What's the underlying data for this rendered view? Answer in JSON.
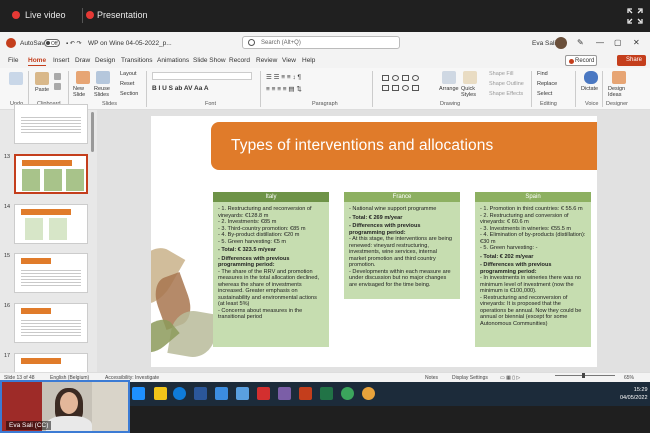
{
  "meeting": {
    "live_label": "Live video",
    "present_label": "Presentation"
  },
  "titlebar": {
    "autosave": "AutoSave",
    "toggle": "Off",
    "filename": "WP on Wine 04-05-2022_p...",
    "search": "Search (Alt+Q)",
    "user": "Eva Sali"
  },
  "menu": {
    "tabs": [
      "File",
      "Home",
      "Insert",
      "Draw",
      "Design",
      "Transitions",
      "Animations",
      "Slide Show",
      "Record",
      "Review",
      "View",
      "Help"
    ],
    "record": "Record",
    "share": "Share"
  },
  "ribbon": {
    "groups": [
      "Undo",
      "Clipboard",
      "Slides",
      "Font",
      "Paragraph",
      "Drawing",
      "Editing",
      "Voice",
      "Designer"
    ],
    "paste": "Paste",
    "new_slide": "New Slide",
    "reuse_slides": "Reuse Slides",
    "layout": "Layout",
    "reset": "Reset",
    "section": "Section",
    "arrange": "Arrange",
    "quick_styles": "Quick Styles",
    "shape_fill": "Shape Fill",
    "shape_outline": "Shape Outline",
    "shape_effects": "Shape Effects",
    "find": "Find",
    "replace": "Replace",
    "select": "Select",
    "dictate": "Dictate",
    "design_ideas": "Design Ideas"
  },
  "thumbnails": [
    {
      "num": "13"
    },
    {
      "num": "14"
    },
    {
      "num": "15"
    },
    {
      "num": "16"
    },
    {
      "num": "17"
    }
  ],
  "slide": {
    "title": "Types of interventions and allocations",
    "columns": [
      {
        "header": "Italy",
        "lines": [
          {
            "t": "- 1. Restructuring and reconversion of vineyards: €128.8 m",
            "b": false
          },
          {
            "t": "- 2. Investments: €85 m",
            "b": false
          },
          {
            "t": "- 3. Third-country promotion: €85 m",
            "b": false
          },
          {
            "t": "- 4. By-product distillation: €20 m",
            "b": false
          },
          {
            "t": "- 5. Green harvesting: €5 m",
            "b": false
          },
          {
            "t": "- Total: € 323.5 m/year",
            "b": true
          },
          {
            "t": "- Differences with previous programming period:",
            "b": true
          },
          {
            "t": "- The share of the RRV and promotion measures in the total allocation declined, whereas the share of investments increased. Greater emphasis on sustainability and environmental actions (at least 5%)",
            "b": false
          },
          {
            "t": "- Concerns about measures in the transitional period",
            "b": false
          }
        ]
      },
      {
        "header": "France",
        "lines": [
          {
            "t": "- National wine support programme",
            "b": false
          },
          {
            "t": "- Total: € 269 m/year",
            "b": true
          },
          {
            "t": "- Differences with previous programming period:",
            "b": true
          },
          {
            "t": "- At this stage, the interventions are being renewed: vineyard restructuring, investments, wine services, internal market promotion and third country promotion.",
            "b": false
          },
          {
            "t": "- Developments within each measure are under discussion but no major changes are envisaged for the time being.",
            "b": false
          }
        ]
      },
      {
        "header": "Spain",
        "lines": [
          {
            "t": "- 1. Promotion in third countries: € 55.6 m",
            "b": false
          },
          {
            "t": "- 2. Restructuring and conversion of vineyards: € 60.6 m",
            "b": false
          },
          {
            "t": "- 3. Investments in wineries: €55.5 m",
            "b": false
          },
          {
            "t": "- 4. Elimination of by-products (distillation): €30 m",
            "b": false
          },
          {
            "t": "- 5. Green harvesting: -",
            "b": false
          },
          {
            "t": "- Total: € 202 m/year",
            "b": true
          },
          {
            "t": "- Differences with previous programming period:",
            "b": true
          },
          {
            "t": "- In investments in wineries there was no minimum level of investment (now the minimum is €100,000).",
            "b": false
          },
          {
            "t": "- Restructuring and reconversion of vineyards: It is proposed that the operations be annual. Now they could be annual or biennial (except for some Autonomous Communities)",
            "b": false
          }
        ]
      }
    ]
  },
  "status": {
    "slide": "Slide 13 of 48",
    "lang": "English (Belgium)",
    "access": "Accessibility: Investigate",
    "notes": "Notes",
    "display": "Display Settings",
    "zoom": "65%"
  },
  "taskbar": {
    "time": "15:29",
    "date": "04/05/2022"
  },
  "webcam": {
    "name": "Eva Sali (CC)"
  }
}
